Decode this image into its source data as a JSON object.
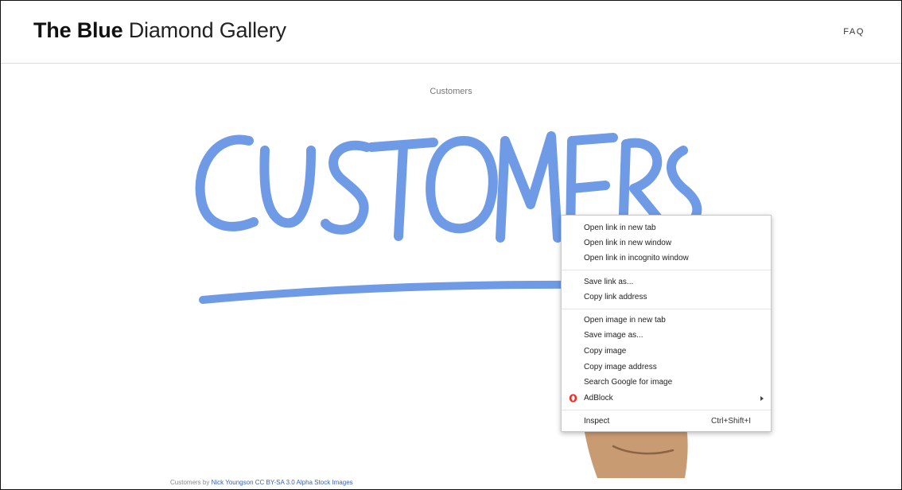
{
  "header": {
    "title_bold": "The Blue",
    "title_rest": "Diamond Gallery",
    "faq_label": "FAQ"
  },
  "image": {
    "caption": "Customers",
    "artwork_text": "CUSTOMERS",
    "colors": {
      "ink": "#6f9be6",
      "skin": "#c99b72"
    }
  },
  "attribution": {
    "prefix": "Customers by",
    "author": "Nick Youngson",
    "license": "CC BY-SA 3.0",
    "source": "Alpha Stock Images"
  },
  "context_menu": {
    "groups": [
      [
        {
          "label": "Open link in new tab"
        },
        {
          "label": "Open link in new window"
        },
        {
          "label": "Open link in incognito window"
        }
      ],
      [
        {
          "label": "Save link as..."
        },
        {
          "label": "Copy link address"
        }
      ],
      [
        {
          "label": "Open image in new tab"
        },
        {
          "label": "Save image as..."
        },
        {
          "label": "Copy image"
        },
        {
          "label": "Copy image address"
        },
        {
          "label": "Search Google for image"
        },
        {
          "label": "AdBlock",
          "icon": "adblock-icon",
          "submenu": true
        }
      ],
      [
        {
          "label": "Inspect",
          "shortcut": "Ctrl+Shift+I"
        }
      ]
    ]
  }
}
